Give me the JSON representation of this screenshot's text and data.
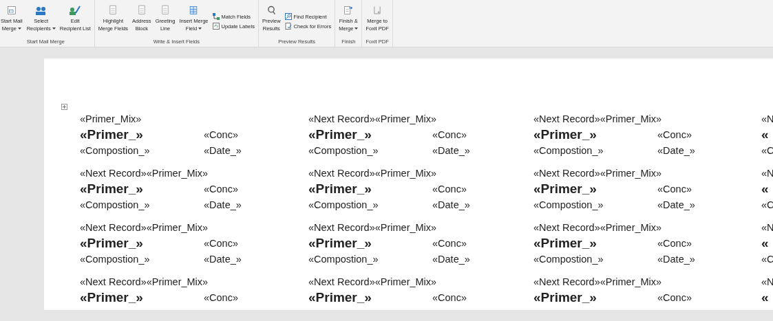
{
  "ribbon": {
    "groups": [
      {
        "label": "Start Mail Merge",
        "buttons": [
          {
            "kind": "large",
            "lines": [
              "Start Mail",
              "Merge"
            ],
            "dropdown": true
          },
          {
            "kind": "large",
            "lines": [
              "Select",
              "Recipients"
            ],
            "dropdown": true
          },
          {
            "kind": "large",
            "lines": [
              "Edit",
              "Recipient List"
            ],
            "dropdown": false
          }
        ]
      },
      {
        "label": "Write & Insert Fields",
        "buttons": [
          {
            "kind": "large",
            "lines": [
              "Highlight",
              "Merge Fields"
            ],
            "dropdown": false
          },
          {
            "kind": "large",
            "lines": [
              "Address",
              "Block"
            ],
            "dropdown": false
          },
          {
            "kind": "large",
            "lines": [
              "Greeting",
              "Line"
            ],
            "dropdown": false
          },
          {
            "kind": "large",
            "lines": [
              "Insert Merge",
              "Field"
            ],
            "dropdown": true
          },
          {
            "kind": "small",
            "lines": [
              "Match Fields"
            ],
            "dropdown": false
          },
          {
            "kind": "small",
            "lines": [
              "Update Labels"
            ],
            "dropdown": false
          }
        ]
      },
      {
        "label": "Preview Results",
        "buttons": [
          {
            "kind": "large",
            "lines": [
              "Preview",
              "Results"
            ],
            "dropdown": false
          },
          {
            "kind": "small",
            "lines": [
              "Find Recipient"
            ],
            "dropdown": false
          },
          {
            "kind": "small",
            "lines": [
              "Check for Errors"
            ],
            "dropdown": false
          }
        ]
      },
      {
        "label": "Finish",
        "buttons": [
          {
            "kind": "large",
            "lines": [
              "Finish &",
              "Merge"
            ],
            "dropdown": true
          }
        ]
      },
      {
        "label": "Foxit PDF",
        "buttons": [
          {
            "kind": "large",
            "lines": [
              "Merge to",
              "Foxit PDF"
            ],
            "dropdown": false
          }
        ]
      }
    ]
  },
  "labels": [
    [
      {
        "first": "«Primer_Mix»",
        "name": "«Primer_»",
        "conc": "«Conc»",
        "composition": "«Compostion_»",
        "date": "«Date_»"
      },
      {
        "first": "«Next Record»«Primer_Mix»",
        "name": "«Primer_»",
        "conc": "«Conc»",
        "composition": "«Compostion_»",
        "date": "«Date_»"
      },
      {
        "first": "«Next Record»«Primer_Mix»",
        "name": "«Primer_»",
        "conc": "«Conc»",
        "composition": "«Compostion_»",
        "date": "«Date_»"
      },
      {
        "first": "«N",
        "name": "«",
        "composition": "«C"
      }
    ],
    [
      {
        "first": "«Next Record»«Primer_Mix»",
        "name": "«Primer_»",
        "conc": "«Conc»",
        "composition": "«Compostion_»",
        "date": "«Date_»"
      },
      {
        "first": "«Next Record»«Primer_Mix»",
        "name": "«Primer_»",
        "conc": "«Conc»",
        "composition": "«Compostion_»",
        "date": "«Date_»"
      },
      {
        "first": "«Next Record»«Primer_Mix»",
        "name": "«Primer_»",
        "conc": "«Conc»",
        "composition": "«Compostion_»",
        "date": "«Date_»"
      },
      {
        "first": "«N",
        "name": "«",
        "composition": "«C"
      }
    ],
    [
      {
        "first": "«Next Record»«Primer_Mix»",
        "name": "«Primer_»",
        "conc": "«Conc»",
        "composition": "«Compostion_»",
        "date": "«Date_»"
      },
      {
        "first": "«Next Record»«Primer_Mix»",
        "name": "«Primer_»",
        "conc": "«Conc»",
        "composition": "«Compostion_»",
        "date": "«Date_»"
      },
      {
        "first": "«Next Record»«Primer_Mix»",
        "name": "«Primer_»",
        "conc": "«Conc»",
        "composition": "«Compostion_»",
        "date": "«Date_»"
      },
      {
        "first": "«N",
        "name": "«",
        "composition": "«C"
      }
    ],
    [
      {
        "first": "«Next Record»«Primer_Mix»",
        "name": "«Primer_»",
        "conc": "«Conc»"
      },
      {
        "first": "«Next Record»«Primer_Mix»",
        "name": "«Primer_»",
        "conc": "«Conc»"
      },
      {
        "first": "«Next Record»«Primer_Mix»",
        "name": "«Primer_»",
        "conc": "«Conc»"
      },
      {
        "first": "«N",
        "name": "«"
      }
    ]
  ]
}
